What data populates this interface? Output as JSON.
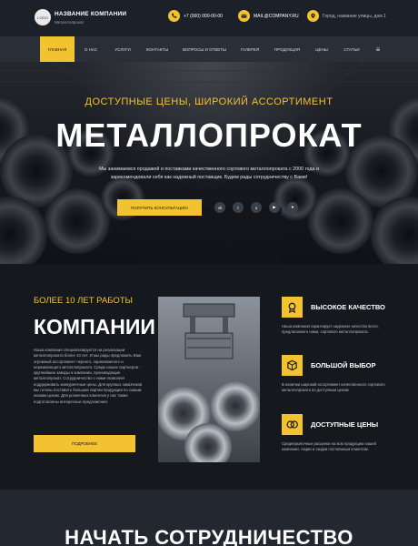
{
  "header": {
    "logo_text": "LOGO",
    "company_name": "НАЗВАНИЕ КОМПАНИИ",
    "company_sub": "Металлопрокат",
    "phone": "+7 (000) 000-00-00",
    "email": "MAIL@COMPANY.RU",
    "address": "Город, название улицы, дом 1"
  },
  "nav": {
    "items": [
      "Главная",
      "О нас",
      "Услуги",
      "Контакты",
      "Вопросы и ответы",
      "Галерея",
      "Продукция",
      "Цены",
      "Статьи"
    ],
    "menu_icon": "≡"
  },
  "hero": {
    "kicker": "ДОСТУПНЫЕ ЦЕНЫ, ШИРОКИЙ АССОРТИМЕНТ",
    "title": "МЕТАЛЛОПРОКАТ",
    "description": "Мы занимаемся продажей и поставками качественного сортового металлопроката с 2000 года и зарекомендовали себя как надежный поставщик. Будем рады сотрудничеству с Вами!",
    "button": "ПОЛУЧИТЬ КОНСУЛЬТАЦИЮ",
    "social": [
      "vk",
      "tw",
      "ok",
      "yt",
      "tg"
    ],
    "social_glyphs": [
      "vk",
      "t",
      "o",
      "▶",
      "➤"
    ]
  },
  "about": {
    "kicker": "БОЛЕЕ 10 ЛЕТ РАБОТЫ",
    "title": "КОМПАНИИ",
    "text": "Наша компания специализируется на реализации металлопроката более 10 лет. И мы рады предложить Вам огромный ассортимент черного, оцинкованного и нержавеющего металлопроката. Среди наших партнеров - крупнейшие заводы и компании, производящие металлопрокат. Сотрудничество с ними позволяет поддерживать конкурентные цены. Для крупных заказчиков мы готовы поставить большие партии продукции по самым низким ценам. Для розничных клиентов у нас также подготовлены интересные предложения.",
    "button": "ПОДРОБНЕЕ"
  },
  "features": [
    {
      "title": "ВЫСОКОЕ КАЧЕСТВО",
      "text": "Наша компания гарантирует надежное качество всего, предлагаемого нами, сортового металлопроката.",
      "icon": "quality-icon"
    },
    {
      "title": "БОЛЬШОЙ ВЫБОР",
      "text": "В наличии широкий ассортимент качественного сортового металлопроката по доступным ценам.",
      "icon": "choice-icon"
    },
    {
      "title": "ДОСТУПНЫЕ ЦЕНЫ",
      "text": "Среднерыночные расценки на всю продукцию нашей компании. Акции и скидки постоянным клиентам.",
      "icon": "price-icon"
    }
  ],
  "bottom": {
    "title": "НАЧАТЬ СОТРУДНИЧЕСТВО"
  },
  "colors": {
    "accent": "#f2c230",
    "dark": "#15181d",
    "nav": "#2a2f37"
  }
}
